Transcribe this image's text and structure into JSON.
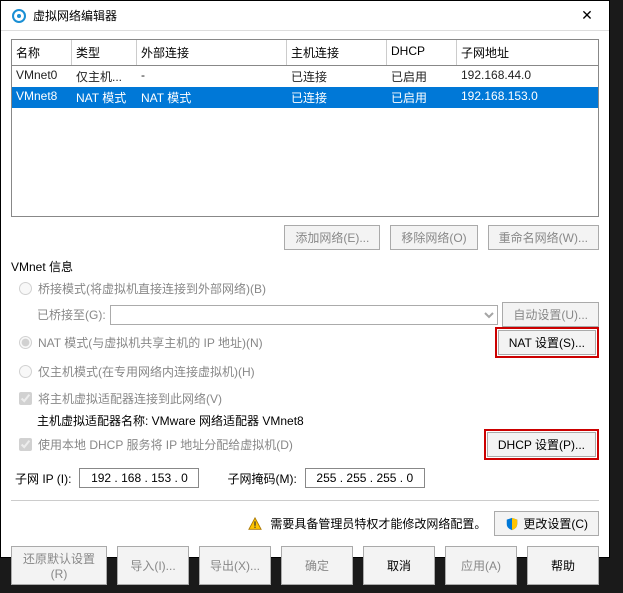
{
  "window": {
    "title": "虚拟网络编辑器"
  },
  "table": {
    "headers": {
      "name": "名称",
      "type": "类型",
      "external": "外部连接",
      "host": "主机连接",
      "dhcp": "DHCP",
      "subnet": "子网地址"
    },
    "rows": [
      {
        "name": "VMnet0",
        "type": "仅主机...",
        "external": "-",
        "host": "已连接",
        "dhcp": "已启用",
        "subnet": "192.168.44.0"
      },
      {
        "name": "VMnet8",
        "type": "NAT 模式",
        "external": "NAT 模式",
        "host": "已连接",
        "dhcp": "已启用",
        "subnet": "192.168.153.0"
      }
    ]
  },
  "buttons": {
    "add_network": "添加网络(E)...",
    "remove_network": "移除网络(O)",
    "rename_network": "重命名网络(W)...",
    "auto_settings": "自动设置(U)...",
    "nat_settings": "NAT 设置(S)...",
    "dhcp_settings": "DHCP 设置(P)...",
    "change_settings": "更改设置(C)",
    "restore_defaults": "还原默认设置(R)",
    "import": "导入(I)...",
    "export": "导出(X)...",
    "ok": "确定",
    "cancel": "取消",
    "apply": "应用(A)",
    "help": "帮助"
  },
  "section": {
    "title": "VMnet 信息",
    "bridge_mode": "桥接模式(将虚拟机直接连接到外部网络)(B)",
    "bridge_to": "已桥接至(G):",
    "nat_mode": "NAT 模式(与虚拟机共享主机的 IP 地址)(N)",
    "hostonly_mode": "仅主机模式(在专用网络内连接虚拟机)(H)",
    "connect_host": "将主机虚拟适配器连接到此网络(V)",
    "adapter_name": "主机虚拟适配器名称: VMware 网络适配器 VMnet8",
    "use_dhcp": "使用本地 DHCP 服务将 IP 地址分配给虚拟机(D)",
    "subnet_ip_label": "子网 IP (I):",
    "subnet_ip": "192 . 168 . 153 . 0",
    "subnet_mask_label": "子网掩码(M):",
    "subnet_mask": "255 . 255 . 255 . 0"
  },
  "footer": {
    "admin_note": "需要具备管理员特权才能修改网络配置。"
  },
  "icons": {
    "app": "app-icon",
    "close": "close-icon",
    "warn": "warning-icon",
    "shield": "shield-icon"
  }
}
